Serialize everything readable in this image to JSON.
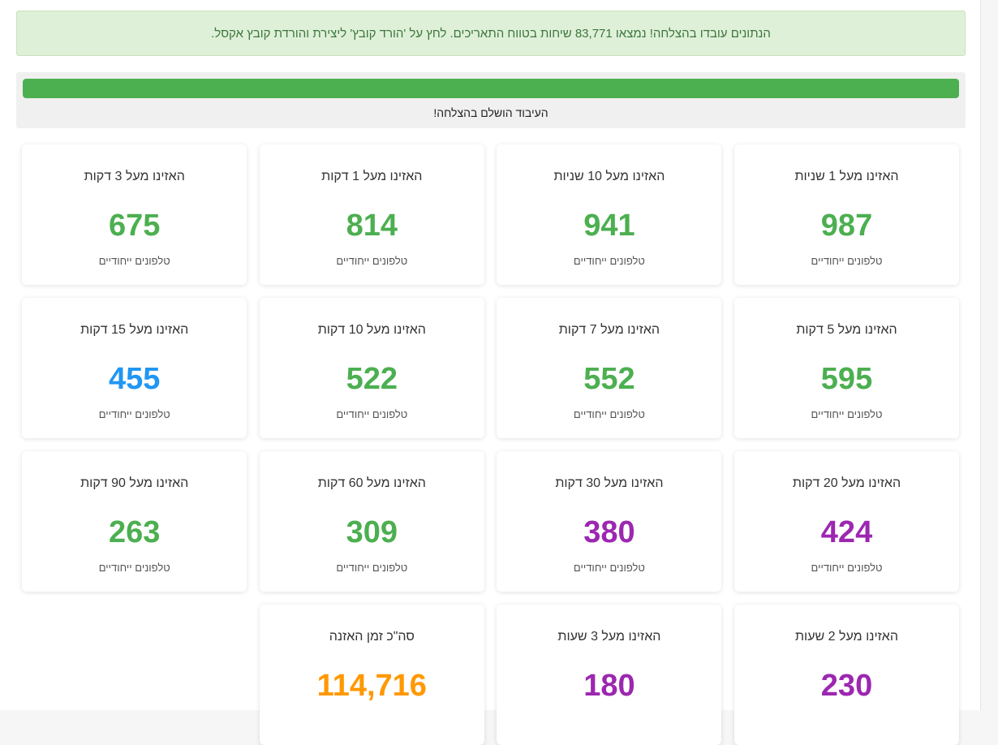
{
  "alert": {
    "message": "הנתונים עובדו בהצלחה! נמצאו 83,771 שיחות בטווח התאריכים. לחץ על 'הורד קובץ' ליצירת והורדת קובץ אקסל."
  },
  "progress": {
    "percent": 100,
    "status_text": "העיבוד הושלם בהצלחה!",
    "color": "#4caf50"
  },
  "colors": {
    "green": "#4caf50",
    "blue": "#2196f3",
    "purple": "#9c27b0",
    "orange": "#ff9800"
  },
  "cards": [
    {
      "title": "האזינו מעל 1 שניות",
      "value": "987",
      "subtitle": "טלפונים ייחודיים",
      "color": "green"
    },
    {
      "title": "האזינו מעל 10 שניות",
      "value": "941",
      "subtitle": "טלפונים ייחודיים",
      "color": "green"
    },
    {
      "title": "האזינו מעל 1 דקות",
      "value": "814",
      "subtitle": "טלפונים ייחודיים",
      "color": "green"
    },
    {
      "title": "האזינו מעל 3 דקות",
      "value": "675",
      "subtitle": "טלפונים ייחודיים",
      "color": "green"
    },
    {
      "title": "האזינו מעל 5 דקות",
      "value": "595",
      "subtitle": "טלפונים ייחודיים",
      "color": "green"
    },
    {
      "title": "האזינו מעל 7 דקות",
      "value": "552",
      "subtitle": "טלפונים ייחודיים",
      "color": "green"
    },
    {
      "title": "האזינו מעל 10 דקות",
      "value": "522",
      "subtitle": "טלפונים ייחודיים",
      "color": "green"
    },
    {
      "title": "האזינו מעל 15 דקות",
      "value": "455",
      "subtitle": "טלפונים ייחודיים",
      "color": "blue"
    },
    {
      "title": "האזינו מעל 20 דקות",
      "value": "424",
      "subtitle": "טלפונים ייחודיים",
      "color": "purple"
    },
    {
      "title": "האזינו מעל 30 דקות",
      "value": "380",
      "subtitle": "טלפונים ייחודיים",
      "color": "purple"
    },
    {
      "title": "האזינו מעל 60 דקות",
      "value": "309",
      "subtitle": "טלפונים ייחודיים",
      "color": "green"
    },
    {
      "title": "האזינו מעל 90 דקות",
      "value": "263",
      "subtitle": "טלפונים ייחודיים",
      "color": "green"
    },
    {
      "title": "האזינו מעל 2 שעות",
      "value": "230",
      "subtitle": "",
      "color": "purple"
    },
    {
      "title": "האזינו מעל 3 שעות",
      "value": "180",
      "subtitle": "",
      "color": "purple"
    },
    {
      "title": "סה\"כ זמן האזנה",
      "value": "114,716",
      "subtitle": "",
      "color": "orange"
    }
  ]
}
